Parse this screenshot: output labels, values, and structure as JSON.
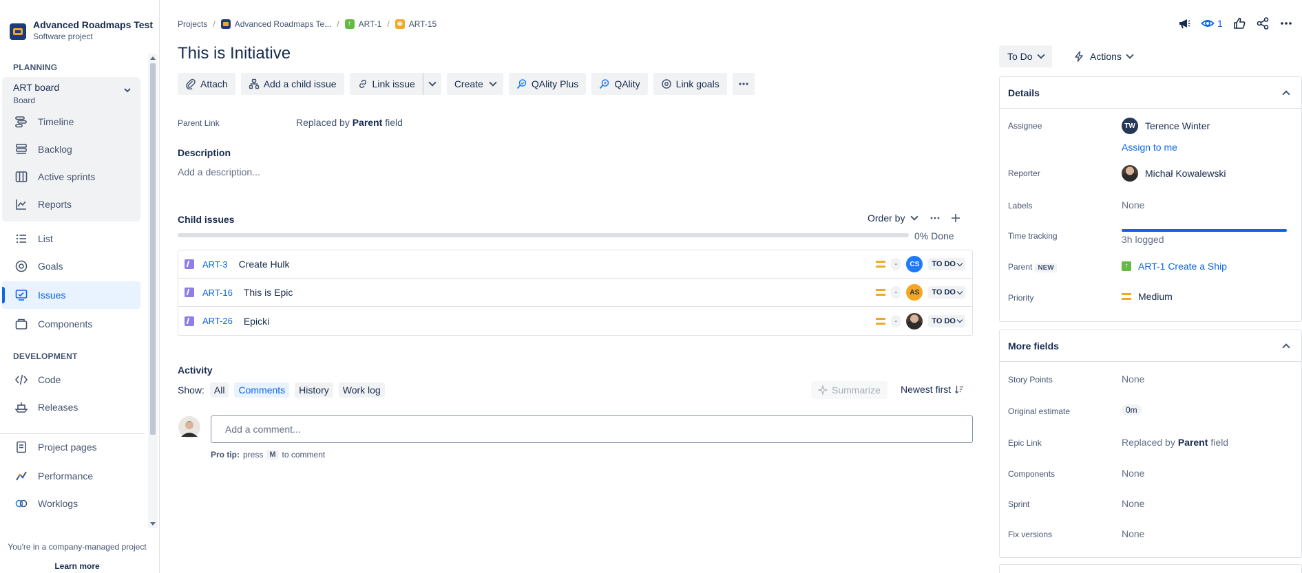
{
  "sidebar": {
    "project_name": "Advanced Roadmaps Test",
    "project_type": "Software project",
    "planning_label": "PLANNING",
    "board_title": "ART board",
    "board_sub": "Board",
    "board_items": [
      {
        "label": "Timeline",
        "icon": "timeline-icon"
      },
      {
        "label": "Backlog",
        "icon": "backlog-icon"
      },
      {
        "label": "Active sprints",
        "icon": "board-columns-icon"
      },
      {
        "label": "Reports",
        "icon": "chart-icon"
      }
    ],
    "items": [
      {
        "label": "List",
        "icon": "list-icon"
      },
      {
        "label": "Goals",
        "icon": "target-icon"
      },
      {
        "label": "Issues",
        "icon": "issues-icon",
        "active": true
      },
      {
        "label": "Components",
        "icon": "component-icon"
      }
    ],
    "development_label": "DEVELOPMENT",
    "dev_items": [
      {
        "label": "Code",
        "icon": "code-icon"
      },
      {
        "label": "Releases",
        "icon": "ship-icon"
      }
    ],
    "bottom_items": [
      {
        "label": "Project pages",
        "icon": "page-icon"
      },
      {
        "label": "Performance",
        "icon": "performance-icon"
      },
      {
        "label": "Worklogs",
        "icon": "worklog-icon"
      }
    ],
    "footer_text": "You're in a company-managed project",
    "footer_link": "Learn more"
  },
  "breadcrumb": {
    "projects": "Projects",
    "project": "Advanced Roadmaps Te...",
    "parent": "ART-1",
    "current": "ART-15",
    "sep": "/"
  },
  "issue": {
    "title": "This is Initiative"
  },
  "toolbar": {
    "attach": "Attach",
    "add_child": "Add a child issue",
    "link_issue": "Link issue",
    "create": "Create",
    "qality_plus": "QAlity Plus",
    "qality": "QAlity",
    "link_goals": "Link goals"
  },
  "fields": {
    "parent_link_label": "Parent Link",
    "parent_link_prefix": "Replaced by",
    "parent_link_bold": "Parent",
    "parent_link_suffix": "field",
    "description_label": "Description",
    "description_placeholder": "Add a description..."
  },
  "child_issues": {
    "label": "Child issues",
    "order_by": "Order by",
    "progress_percent": 0,
    "progress_text": "0% Done",
    "rows": [
      {
        "key": "ART-3",
        "summary": "Create Hulk",
        "assignee": "CS",
        "status": "TO DO",
        "dash": "-"
      },
      {
        "key": "ART-16",
        "summary": "This is Epic",
        "assignee": "AS",
        "status": "TO DO",
        "dash": "-"
      },
      {
        "key": "ART-26",
        "summary": "Epicki",
        "assignee": "",
        "status": "TO DO",
        "dash": "-"
      }
    ]
  },
  "activity": {
    "label": "Activity",
    "show": "Show:",
    "filters": [
      "All",
      "Comments",
      "History",
      "Work log"
    ],
    "selected": "Comments",
    "summarize": "Summarize",
    "newest": "Newest first",
    "comment_placeholder": "Add a comment...",
    "pro_tip_bold": "Pro tip:",
    "pro_tip_press": "press",
    "pro_tip_key": "M",
    "pro_tip_suffix": "to comment"
  },
  "header_right": {
    "watch_count": "1",
    "status": "To Do",
    "actions": "Actions"
  },
  "details": {
    "title": "Details",
    "assignee_label": "Assignee",
    "assignee_initials": "TW",
    "assignee_name": "Terence Winter",
    "assign_to_me": "Assign to me",
    "reporter_label": "Reporter",
    "reporter_name": "Michał Kowalewski",
    "labels_label": "Labels",
    "labels_value": "None",
    "time_label": "Time tracking",
    "time_value": "3h logged",
    "parent_label": "Parent",
    "parent_new": "NEW",
    "parent_value": "ART-1 Create a Ship",
    "priority_label": "Priority",
    "priority_value": "Medium"
  },
  "more_fields": {
    "title": "More fields",
    "story_points_label": "Story Points",
    "story_points_value": "None",
    "orig_est_label": "Original estimate",
    "orig_est_value": "0m",
    "epic_link_label": "Epic Link",
    "epic_link_prefix": "Replaced by",
    "epic_link_bold": "Parent",
    "epic_link_suffix": "field",
    "components_label": "Components",
    "components_value": "None",
    "sprint_label": "Sprint",
    "sprint_value": "None",
    "fix_versions_label": "Fix versions",
    "fix_versions_value": "None"
  },
  "colors": {
    "brand_blue": "#0c66e4",
    "priority_medium": "#f5a623",
    "epic_purple": "#8f7ee7"
  }
}
